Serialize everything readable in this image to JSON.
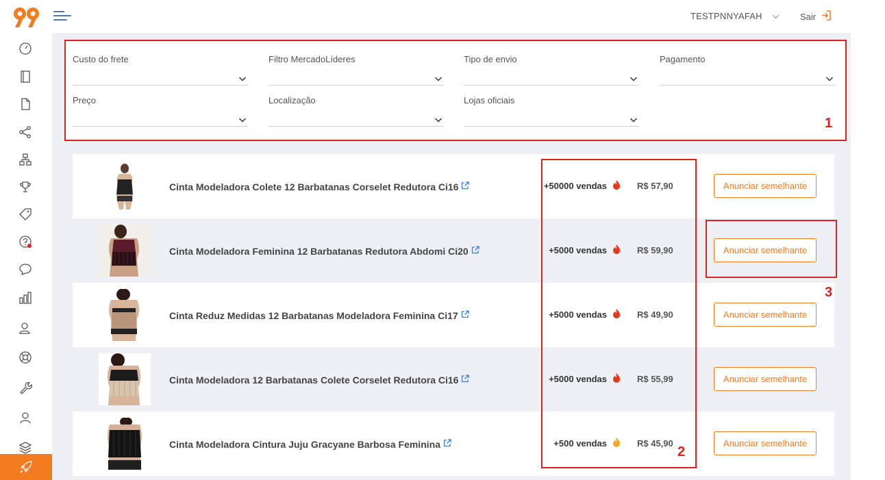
{
  "header": {
    "username": "TESTPNNYAFAH",
    "logout_label": "Sair",
    "accent_color": "#f47c20"
  },
  "sidebar": {
    "icons": [
      "speedometer-icon",
      "notebook-icon",
      "document-icon",
      "share-icon",
      "sitemap-icon",
      "trophy-icon",
      "tag-icon",
      "question-notification-icon",
      "chat-bubble-icon",
      "bar-chart-icon",
      "users-icon",
      "lifebuoy-icon",
      "wrench-icon",
      "user-icon",
      "layers-icon",
      "rocket-icon"
    ],
    "active": "rocket-icon"
  },
  "filters": [
    {
      "label": "Custo do frete",
      "value": ""
    },
    {
      "label": "Filtro MercadoLíderes",
      "value": ""
    },
    {
      "label": "Tipo de envio",
      "value": ""
    },
    {
      "label": "Pagamento",
      "value": ""
    },
    {
      "label": "Preço",
      "value": ""
    },
    {
      "label": "Localização",
      "value": ""
    },
    {
      "label": "Lojas oficiais",
      "value": ""
    }
  ],
  "products": [
    {
      "title": "Cinta Modeladora Colete 12 Barbatanas Corselet Redutora Ci16",
      "sales": "+50000 vendas",
      "flame_color": "#e8381b",
      "price": "R$ 57,90",
      "button": "Anunciar semelhante"
    },
    {
      "title": "Cinta Modeladora Feminina 12 Barbatanas Redutora Abdomi Ci20",
      "sales": "+5000 vendas",
      "flame_color": "#e8381b",
      "price": "R$ 59,90",
      "button": "Anunciar semelhante"
    },
    {
      "title": "Cinta Reduz Medidas 12 Barbatanas Modeladora Feminina Ci17",
      "sales": "+5000 vendas",
      "flame_color": "#e8381b",
      "price": "R$ 49,90",
      "button": "Anunciar semelhante"
    },
    {
      "title": "Cinta Modeladora 12 Barbatanas Colete Corselet Redutora Ci16",
      "sales": "+5000 vendas",
      "flame_color": "#e8381b",
      "price": "R$ 55,99",
      "button": "Anunciar semelhante"
    },
    {
      "title": "Cinta Modeladora Cintura Juju Gracyane Barbosa Feminina",
      "sales": "+500 vendas",
      "flame_color": "#f5a623",
      "price": "R$ 45,90",
      "button": "Anunciar semelhante"
    }
  ],
  "annotations": [
    "1",
    "2",
    "3"
  ],
  "annotation_color": "#e0201c"
}
